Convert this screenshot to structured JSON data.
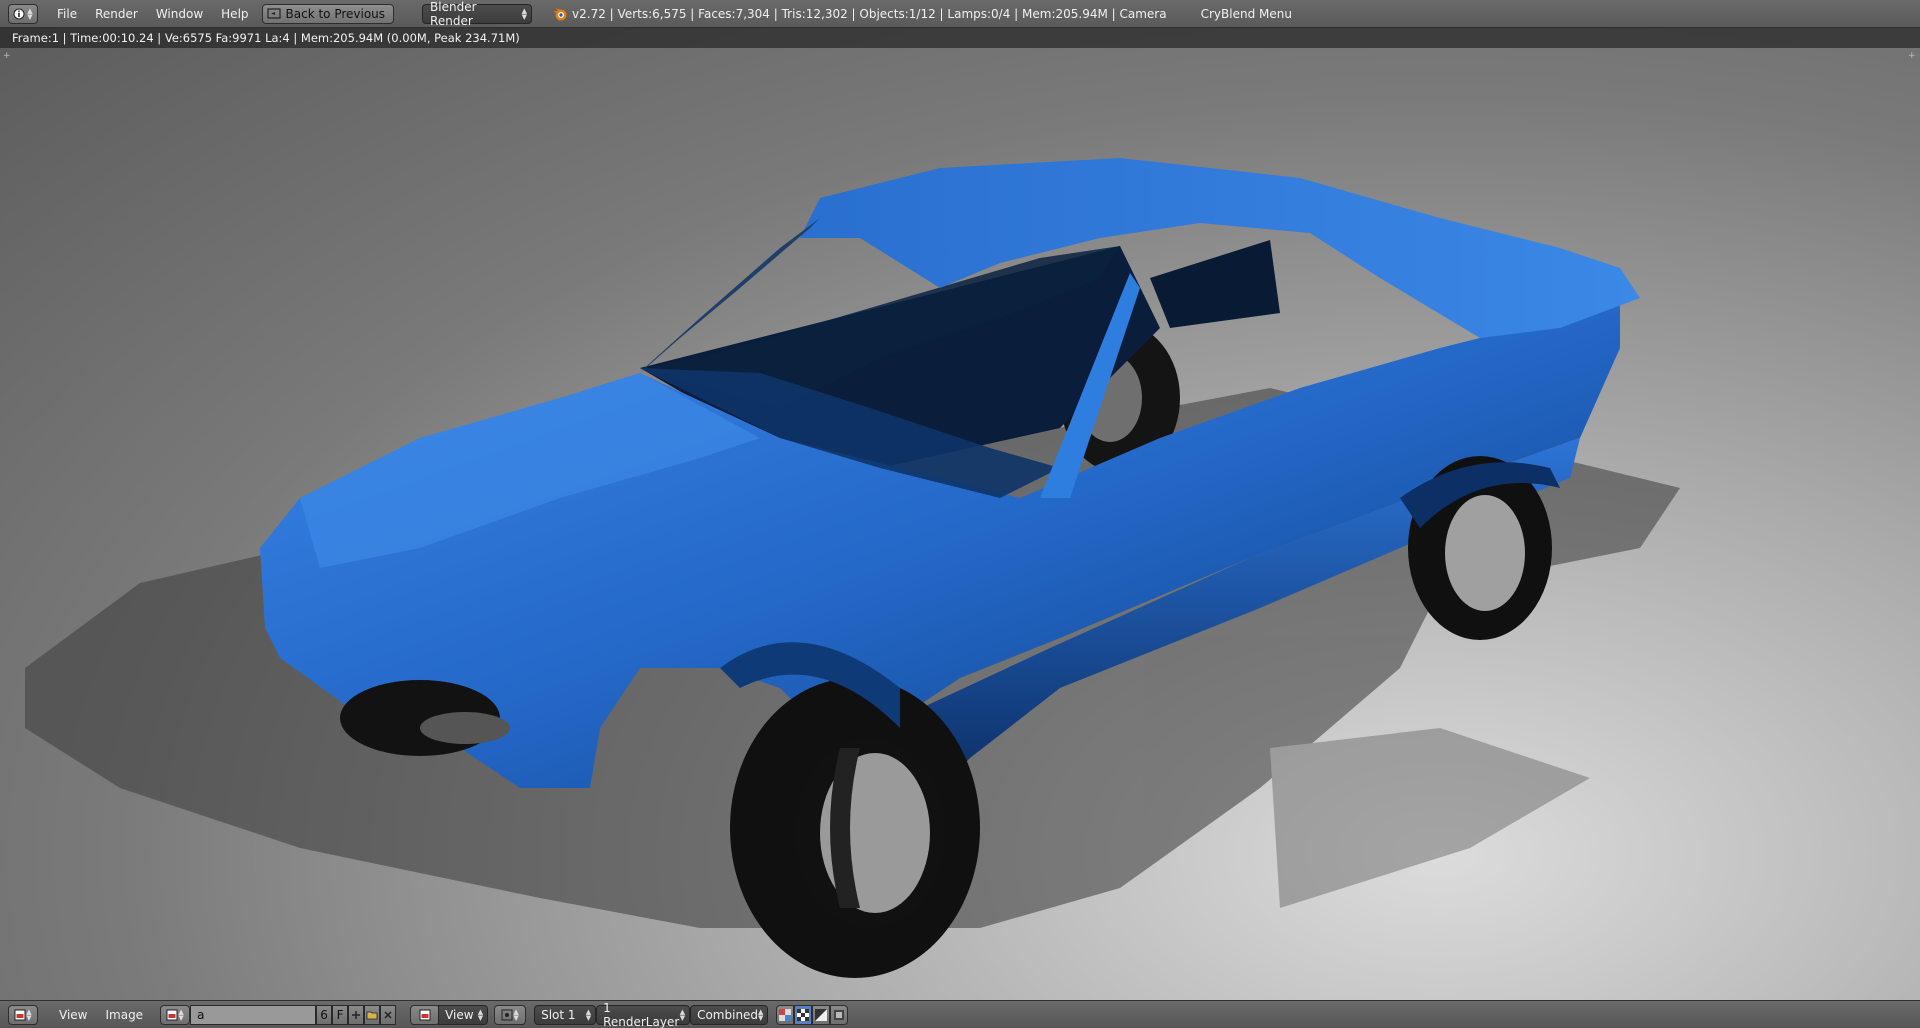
{
  "header": {
    "menu": [
      "File",
      "Render",
      "Window",
      "Help"
    ],
    "back_button": "Back to Previous",
    "render_engine": "Blender Render",
    "stats": "v2.72 | Verts:6,575 | Faces:7,304 | Tris:12,302 | Objects:1/12 | Lamps:0/4 | Mem:205.94M | Camera",
    "addon_menu": "CryBlend Menu"
  },
  "render_info": "Frame:1 | Time:00:10.24 | Ve:6575 Fa:9971 La:4 | Mem:205.94M (0.00M, Peak 234.71M)",
  "image_editor": {
    "menu": [
      "View",
      "Image"
    ],
    "image_name": "a",
    "users": "6",
    "fake_user": "F",
    "view_select": "View",
    "slot": "Slot 1",
    "render_layer": "1 RenderLayer",
    "pass": "Combined"
  },
  "colors": {
    "car_body": "#2a6fd0",
    "tires": "#111111",
    "header_bg": "#626262"
  }
}
